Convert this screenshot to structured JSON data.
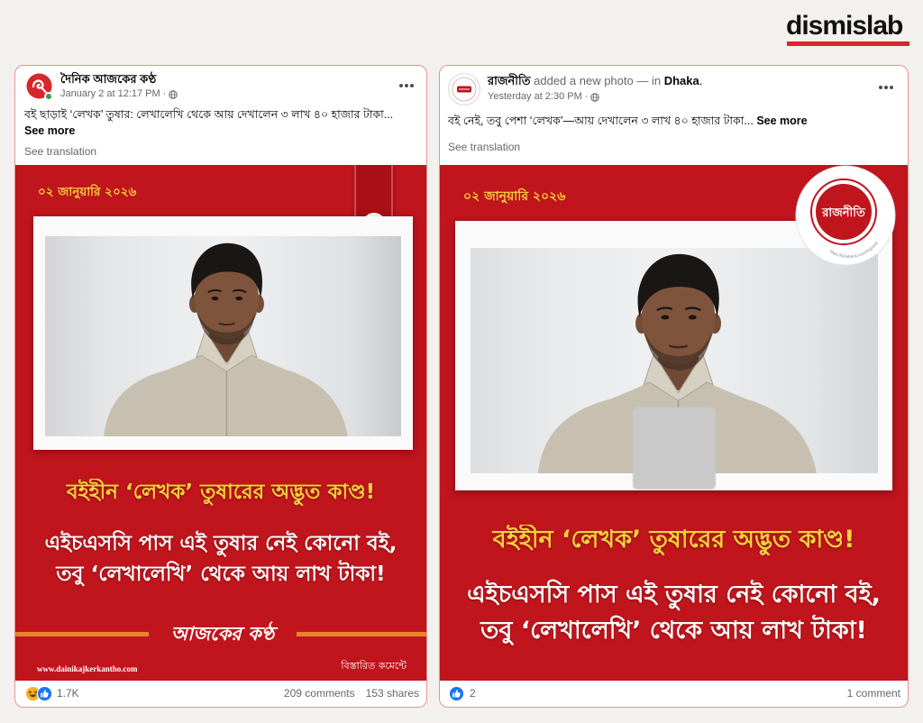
{
  "brand": {
    "logo_text": "dismislab"
  },
  "colors": {
    "brand_red": "#d7262d",
    "card_red": "#c0151c",
    "headline_yellow": "#f6d23c",
    "banner_orange": "#e8842c",
    "link_blue": "#1877f2",
    "meta_gray": "#65676b",
    "online_green": "#31a24c"
  },
  "posts": [
    {
      "page_name": "দৈনিক আজকের কণ্ঠ",
      "timestamp": "January 2 at 12:17 PM",
      "separator": "·",
      "privacy_icon": "globe-icon",
      "caption": "বই ছাড়াই ‘লেখক’ তুষার: লেখালেখি থেকে আয় দেখালেন ৩ লাখ ৪০ হাজার টাকা...",
      "see_more": "See more",
      "see_translation": "See translation",
      "card": {
        "date": "০২ জানুয়ারি ২০২৬",
        "headline": "বইহীন ‘লেখক’ তুষারের অদ্ভুত কাণ্ড!",
        "line1": "এইচএসসি পাস এই তুষার নেই কোনো বই,",
        "line2": "তবু ‘লেখালেখি’ থেকে আয় লাখ টাকা!",
        "brand": "আজকের কণ্ঠ",
        "website": "www.dainikajkerkantho.com",
        "details": "বিস্তারিত কমেন্টে"
      },
      "reactions": {
        "icons": [
          "haha-icon",
          "like-icon"
        ],
        "count": "1.7K"
      },
      "comments": "209 comments",
      "shares": "153 shares"
    },
    {
      "page_name": "রাজনীতি",
      "action": "added a new photo — in",
      "location": "Dhaka",
      "location_end": ".",
      "timestamp": "Yesterday at 2:30 PM",
      "separator": "·",
      "privacy_icon": "globe-icon",
      "caption": "বই নেই, তবু পেশা ‘লেখক’—আয় দেখালেন ৩ লাখ ৪০ হাজার টাকা...",
      "see_more": "See more",
      "see_translation": "See translation",
      "card": {
        "date": "০২ জানুয়ারি ২০২৬",
        "logo_text": "রাজনীতি",
        "logo_url": "https://facebook.com/Rajneeti",
        "headline": "বইহীন ‘লেখক’ তুষারের অদ্ভুত কাণ্ড!",
        "line1": "এইচএসসি পাস এই তুষার নেই কোনো বই,",
        "line2": "তবু ‘লেখালেখি’ থেকে আয় লাখ টাকা!"
      },
      "reactions": {
        "icons": [
          "like-icon"
        ],
        "count": "2"
      },
      "comments": "1 comment"
    }
  ]
}
